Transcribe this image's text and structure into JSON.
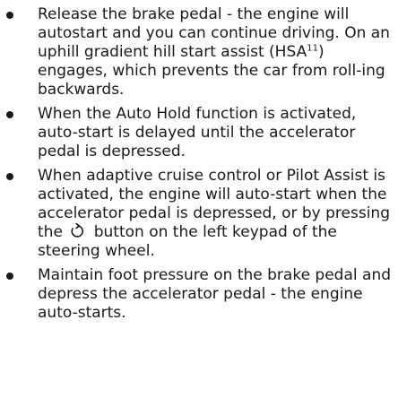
{
  "bullets": [
    {
      "text_before_sup": "Release the brake pedal - the engine will autostart and you can continue driving. On an uphill gradient hill start assist (HSA",
      "sup": "11",
      "text_after_sup": ") engages, which prevents the car from roll-ing backwards."
    },
    {
      "text": "When the Auto Hold function is activated, auto-start is delayed until the accelerator pedal is depressed."
    },
    {
      "text_before_icon": "When adaptive cruise control or Pilot Assist is activated, the engine will auto-start when the accelerator pedal is depressed, or by pressing the",
      "icon": "resume-arrow-icon",
      "text_after_icon": "button on the left keypad of the steering wheel."
    },
    {
      "text": "Maintain foot pressure on the brake pedal and depress the accelerator pedal - the engine auto-starts."
    }
  ],
  "colors": {
    "text": "#1a1a1a",
    "bullet": "#1a1a1a",
    "background": "#ffffff"
  }
}
